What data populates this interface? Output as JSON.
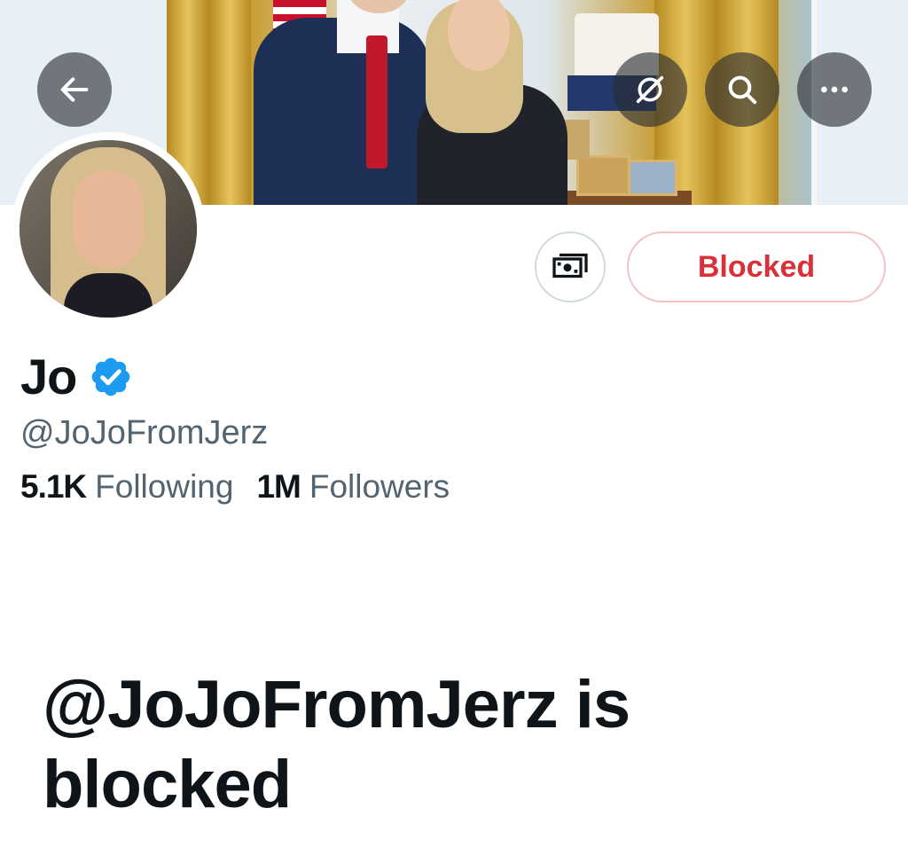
{
  "header": {
    "back_icon": "arrow-left-icon",
    "grok_icon": "grok-icon",
    "search_icon": "search-icon",
    "more_icon": "more-horizontal-icon"
  },
  "profile": {
    "display_name": "Jo",
    "verified_icon": "verified-badge-icon",
    "handle": "@JoJoFromJerz",
    "following_count": "5.1K",
    "following_label": "Following",
    "followers_count": "1M",
    "followers_label": "Followers"
  },
  "actions": {
    "tip_icon": "money-icon",
    "blocked_label": "Blocked"
  },
  "blocked_notice": {
    "title": "@JoJoFromJerz is blocked"
  },
  "colors": {
    "blocked_red": "#d9313a",
    "verified_blue": "#1d9bf0",
    "secondary_text": "#536471"
  }
}
